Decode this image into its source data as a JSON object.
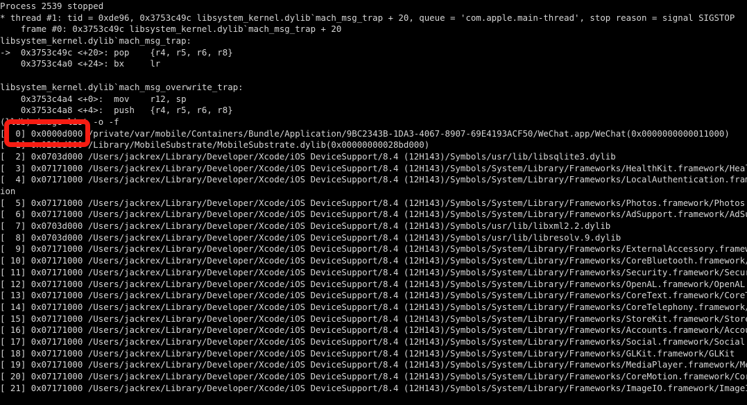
{
  "terminal": {
    "app": "lldb-console",
    "background_color": "#000000",
    "text_color": "#d6d6d6",
    "annotation_color": "#f61c12",
    "lines": [
      "Process 2539 stopped",
      "* thread #1: tid = 0xde96, 0x3753c49c libsystem_kernel.dylib`mach_msg_trap + 20, queue = 'com.apple.main-thread', stop reason = signal SIGSTOP",
      "    frame #0: 0x3753c49c libsystem_kernel.dylib`mach_msg_trap + 20",
      "libsystem_kernel.dylib`mach_msg_trap:",
      "->  0x3753c49c <+20>: pop    {r4, r5, r6, r8}",
      "    0x3753c4a0 <+24>: bx     lr",
      "",
      "libsystem_kernel.dylib`mach_msg_overwrite_trap:",
      "    0x3753c4a4 <+0>:  mov    r12, sp",
      "    0x3753c4a8 <+4>:  push   {r4, r5, r6, r8}",
      "(lldb) image list -o -f",
      "[  0] 0x0000d000 /private/var/mobile/Containers/Bundle/Application/9BC2343B-1DA3-4067-8907-69E4193ACF50/WeChat.app/WeChat(0x0000000000011000)",
      "[  1] 0x028bd000 /Library/MobileSubstrate/MobileSubstrate.dylib(0x00000000028bd000)",
      "[  2] 0x0703d000 /Users/jackrex/Library/Developer/Xcode/iOS DeviceSupport/8.4 (12H143)/Symbols/usr/lib/libsqlite3.dylib",
      "[  3] 0x07171000 /Users/jackrex/Library/Developer/Xcode/iOS DeviceSupport/8.4 (12H143)/Symbols/System/Library/Frameworks/HealthKit.framework/HealthKit",
      "[  4] 0x07171000 /Users/jackrex/Library/Developer/Xcode/iOS DeviceSupport/8.4 (12H143)/Symbols/System/Library/Frameworks/LocalAuthentication.framework/LocalAuthenticat",
      "ion",
      "[  5] 0x07171000 /Users/jackrex/Library/Developer/Xcode/iOS DeviceSupport/8.4 (12H143)/Symbols/System/Library/Frameworks/Photos.framework/Photos",
      "[  6] 0x07171000 /Users/jackrex/Library/Developer/Xcode/iOS DeviceSupport/8.4 (12H143)/Symbols/System/Library/Frameworks/AdSupport.framework/AdSupport",
      "[  7] 0x0703d000 /Users/jackrex/Library/Developer/Xcode/iOS DeviceSupport/8.4 (12H143)/Symbols/usr/lib/libxml2.2.dylib",
      "[  8] 0x0703d000 /Users/jackrex/Library/Developer/Xcode/iOS DeviceSupport/8.4 (12H143)/Symbols/usr/lib/libresolv.9.dylib",
      "[  9] 0x07171000 /Users/jackrex/Library/Developer/Xcode/iOS DeviceSupport/8.4 (12H143)/Symbols/System/Library/Frameworks/ExternalAccessory.framework/Exter",
      "[ 10] 0x07171000 /Users/jackrex/Library/Developer/Xcode/iOS DeviceSupport/8.4 (12H143)/Symbols/System/Library/Frameworks/CoreBluetooth.framework/CoreBluet",
      "[ 11] 0x07171000 /Users/jackrex/Library/Developer/Xcode/iOS DeviceSupport/8.4 (12H143)/Symbols/System/Library/Frameworks/Security.framework/Security",
      "[ 12] 0x07171000 /Users/jackrex/Library/Developer/Xcode/iOS DeviceSupport/8.4 (12H143)/Symbols/System/Library/Frameworks/OpenAL.framework/OpenAL",
      "[ 13] 0x07171000 /Users/jackrex/Library/Developer/Xcode/iOS DeviceSupport/8.4 (12H143)/Symbols/System/Library/Frameworks/CoreText.framework/CoreText",
      "[ 14] 0x07171000 /Users/jackrex/Library/Developer/Xcode/iOS DeviceSupport/8.4 (12H143)/Symbols/System/Library/Frameworks/CoreTelephony.framework/CoreTelep",
      "[ 15] 0x07171000 /Users/jackrex/Library/Developer/Xcode/iOS DeviceSupport/8.4 (12H143)/Symbols/System/Library/Frameworks/StoreKit.framework/StoreKit",
      "[ 16] 0x07171000 /Users/jackrex/Library/Developer/Xcode/iOS DeviceSupport/8.4 (12H143)/Symbols/System/Library/Frameworks/Accounts.framework/Accounts",
      "[ 17] 0x07171000 /Users/jackrex/Library/Developer/Xcode/iOS DeviceSupport/8.4 (12H143)/Symbols/System/Library/Frameworks/Social.framework/Social",
      "[ 18] 0x07171000 /Users/jackrex/Library/Developer/Xcode/iOS DeviceSupport/8.4 (12H143)/Symbols/System/Library/Frameworks/GLKit.framework/GLKit",
      "[ 19] 0x07171000 /Users/jackrex/Library/Developer/Xcode/iOS DeviceSupport/8.4 (12H143)/Symbols/System/Library/Frameworks/MediaPlayer.framework/MediaPlayer",
      "[ 20] 0x07171000 /Users/jackrex/Library/Developer/Xcode/iOS DeviceSupport/8.4 (12H143)/Symbols/System/Library/Frameworks/CoreMotion.framework/CoreMotion",
      "[ 21] 0x07171000 /Users/jackrex/Library/Developer/Xcode/iOS DeviceSupport/8.4 (12H143)/Symbols/System/Library/Frameworks/ImageIO.framework/ImageIO"
    ]
  }
}
